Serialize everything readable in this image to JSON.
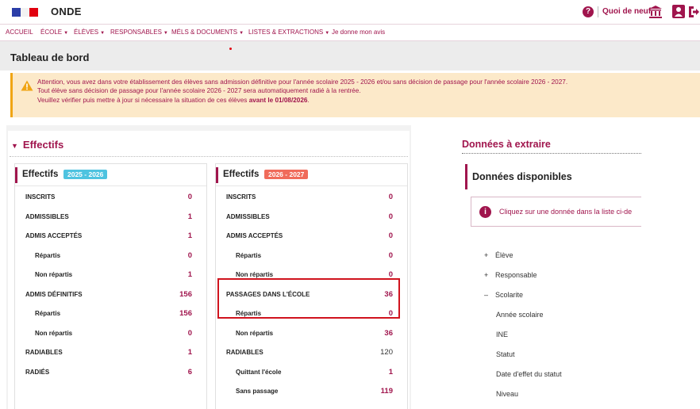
{
  "header": {
    "app_name": "ONDE",
    "help_label": "?",
    "whats_new": "Quoi de neuf"
  },
  "menu": [
    {
      "label": "ACCUEIL",
      "has_caret": false
    },
    {
      "label": "ÉCOLE",
      "has_caret": true
    },
    {
      "label": "ÉLÈVES",
      "has_caret": true
    },
    {
      "label": "RESPONSABLES",
      "has_caret": true
    },
    {
      "label": "MÉLS & DOCUMENTS",
      "has_caret": true
    },
    {
      "label": "LISTES & EXTRACTIONS",
      "has_caret": true
    },
    {
      "label": "Je donne mon avis",
      "has_caret": false
    }
  ],
  "page_title": "Tableau de bord",
  "warning": {
    "line1": "Attention, vous avez dans votre établissement des élèves sans admission définitive pour l'année scolaire 2025 - 2026 et/ou sans décision de passage pour l'année scolaire 2026 - 2027.",
    "line2": "Tout élève sans décision de passage pour l'année scolaire 2026 - 2027 sera automatiquement radié à la rentrée.",
    "line3_prefix": "Veuillez vérifier puis mettre à jour si nécessaire la situation de ces élèves ",
    "line3_bold": "avant le 01/08/2026",
    "line3_suffix": "."
  },
  "effectifs": {
    "section_title": "Effectifs",
    "card_2025": {
      "label": "Effectifs",
      "year": "2025 - 2026",
      "rows": [
        {
          "label": "INSCRITS",
          "value": "0",
          "kind": "main"
        },
        {
          "label": "ADMISSIBLES",
          "value": "1",
          "kind": "main"
        },
        {
          "label": "ADMIS ACCEPTÉS",
          "value": "1",
          "kind": "main"
        },
        {
          "label": "Répartis",
          "value": "0",
          "kind": "sub"
        },
        {
          "label": "Non répartis",
          "value": "1",
          "kind": "sub"
        },
        {
          "label": "ADMIS DÉFINITIFS",
          "value": "156",
          "kind": "main"
        },
        {
          "label": "Répartis",
          "value": "156",
          "kind": "sub"
        },
        {
          "label": "Non répartis",
          "value": "0",
          "kind": "sub"
        },
        {
          "label": "RADIABLES",
          "value": "1",
          "kind": "main"
        },
        {
          "label": "RADIÉS",
          "value": "6",
          "kind": "main"
        }
      ]
    },
    "card_2026": {
      "label": "Effectifs",
      "year": "2026 - 2027",
      "rows": [
        {
          "label": "INSCRITS",
          "value": "0",
          "kind": "main"
        },
        {
          "label": "ADMISSIBLES",
          "value": "0",
          "kind": "main"
        },
        {
          "label": "ADMIS ACCEPTÉS",
          "value": "0",
          "kind": "main"
        },
        {
          "label": "Répartis",
          "value": "0",
          "kind": "sub"
        },
        {
          "label": "Non répartis",
          "value": "0",
          "kind": "sub"
        },
        {
          "label": "PASSAGES DANS L'ÉCOLE",
          "value": "36",
          "kind": "main"
        },
        {
          "label": "Répartis",
          "value": "0",
          "kind": "sub"
        },
        {
          "label": "Non répartis",
          "value": "36",
          "kind": "sub"
        },
        {
          "label": "RADIABLES",
          "value": "120",
          "kind": "main",
          "plain": true
        },
        {
          "label": "Quittant l'école",
          "value": "1",
          "kind": "sub"
        },
        {
          "label": "Sans passage",
          "value": "119",
          "kind": "sub"
        }
      ]
    }
  },
  "donnees": {
    "title": "Données à extraire",
    "available_title": "Données disponibles",
    "info": "Cliquez sur une donnée dans la liste ci-de",
    "tree": [
      {
        "sign": "+",
        "label": "Élève",
        "level": 0
      },
      {
        "sign": "+",
        "label": "Responsable",
        "level": 0
      },
      {
        "sign": "–",
        "label": "Scolarite",
        "level": 0
      },
      {
        "sign": "",
        "label": "Année scolaire",
        "level": 1
      },
      {
        "sign": "",
        "label": "INE",
        "level": 1
      },
      {
        "sign": "",
        "label": "Statut",
        "level": 1
      },
      {
        "sign": "",
        "label": "Date d'effet du statut",
        "level": 1
      },
      {
        "sign": "",
        "label": "Niveau",
        "level": 1
      }
    ]
  },
  "colors": {
    "accent": "#a0154d",
    "warning_bg": "#fce9c9",
    "badge_2025": "#4ec3e0",
    "badge_2026": "#f06b5a",
    "highlight": "#d0131e"
  }
}
